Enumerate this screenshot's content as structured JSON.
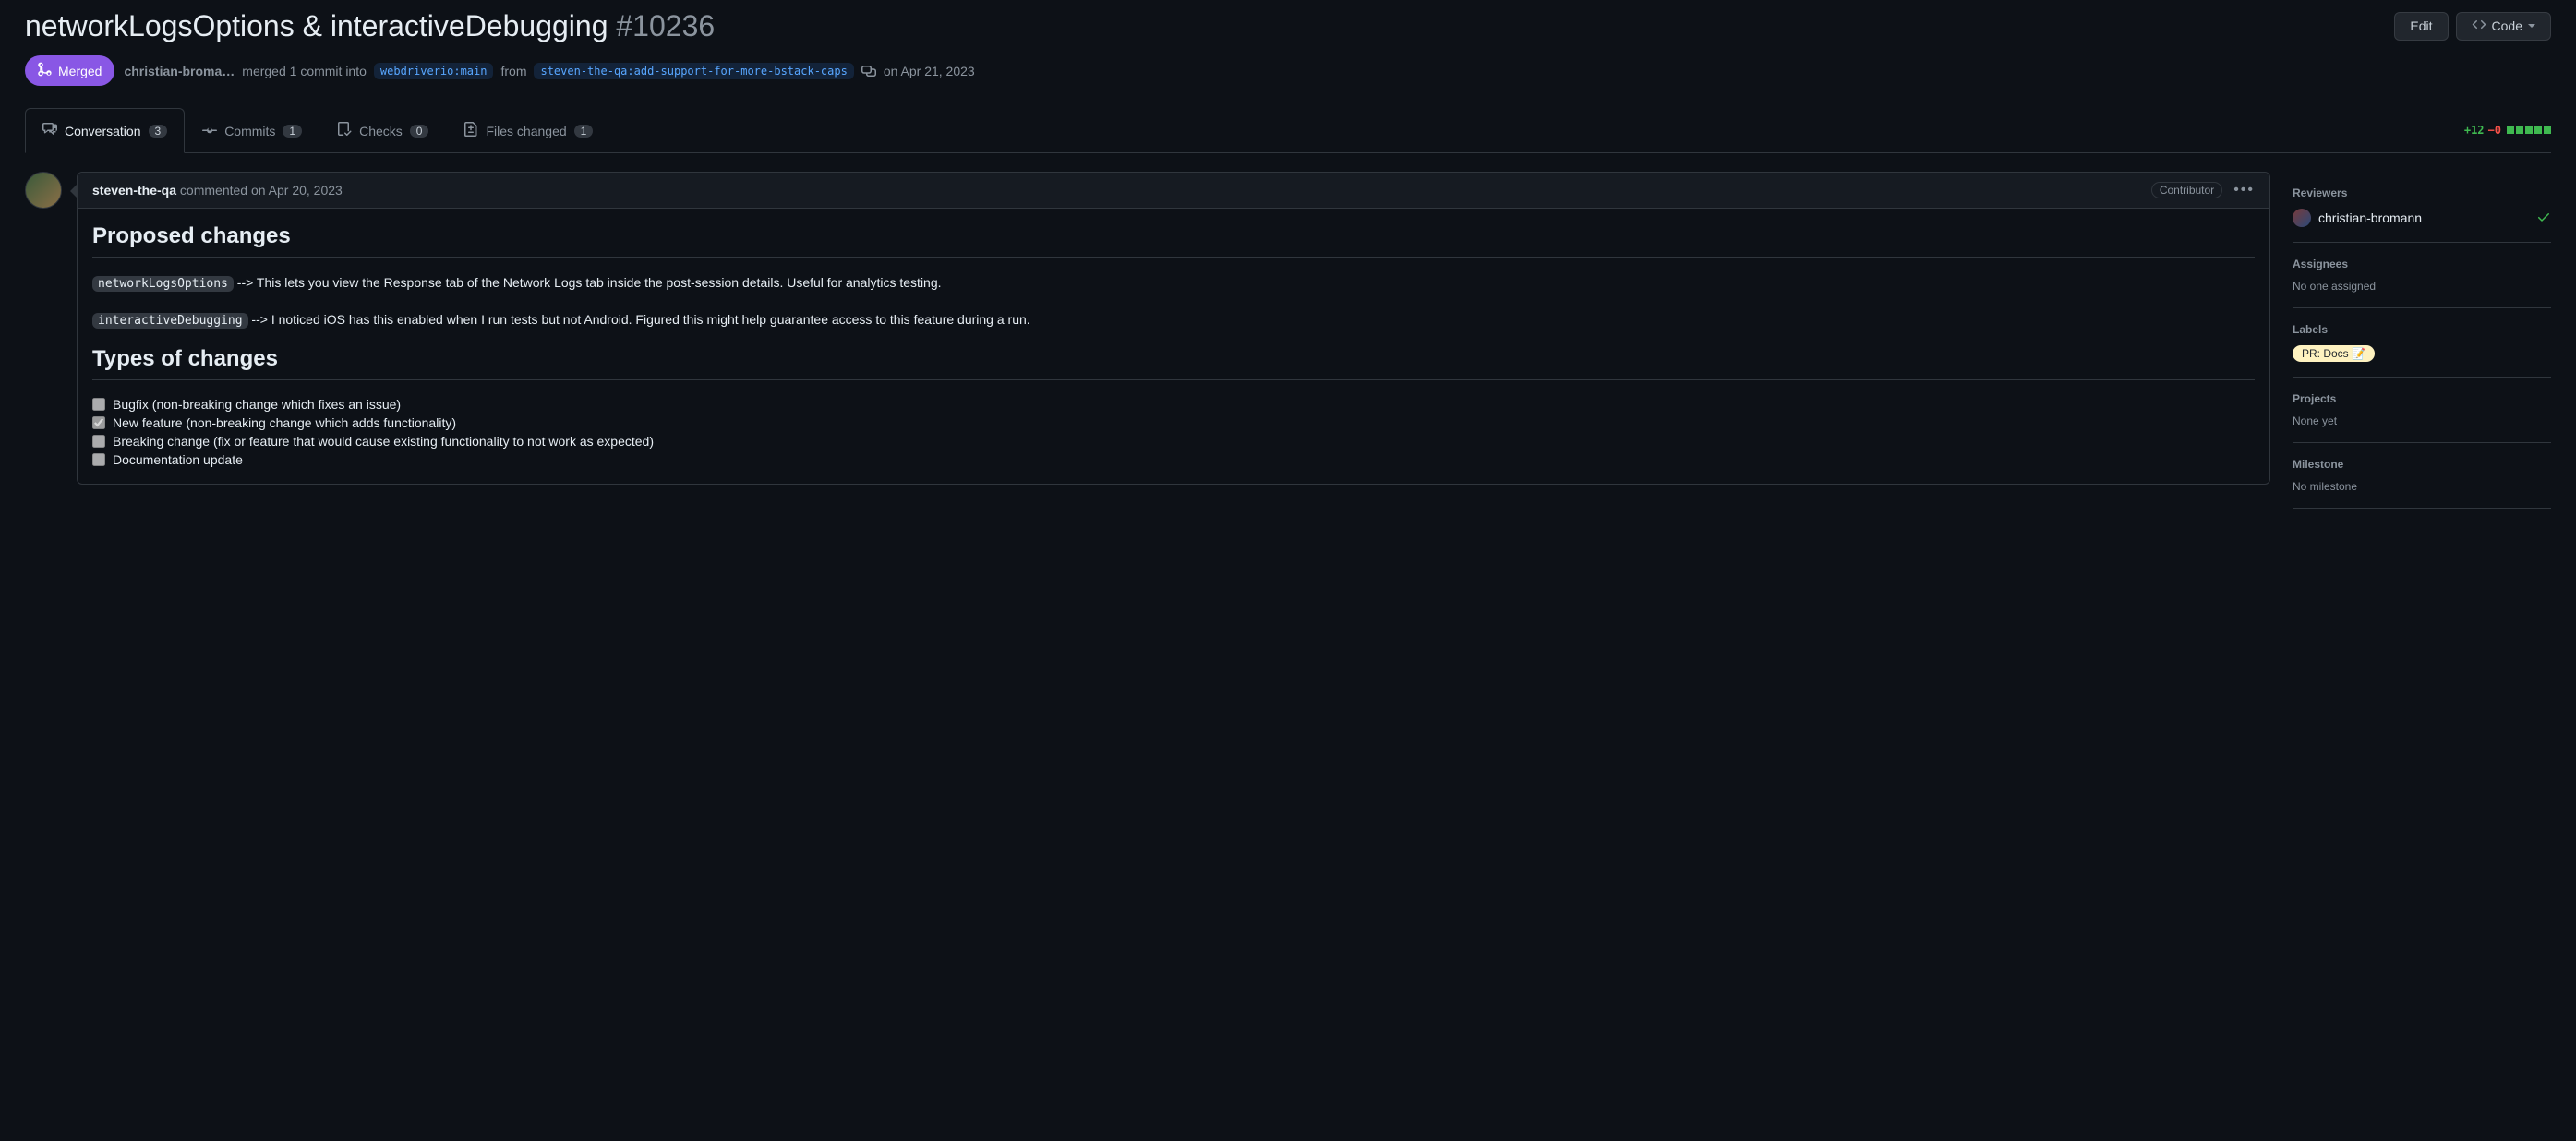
{
  "header": {
    "title": "networkLogsOptions & interactiveDebugging",
    "number": "#10236",
    "edit_label": "Edit",
    "code_label": "Code"
  },
  "meta": {
    "state": "Merged",
    "author": "christian-broma…",
    "merge_text_1": "merged 1 commit into",
    "base_branch": "webdriverio:main",
    "from_text": "from",
    "head_branch": "steven-the-qa:add-support-for-more-bstack-caps",
    "merge_date": "on Apr 21, 2023"
  },
  "tabs": {
    "conversation": {
      "label": "Conversation",
      "count": "3"
    },
    "commits": {
      "label": "Commits",
      "count": "1"
    },
    "checks": {
      "label": "Checks",
      "count": "0"
    },
    "files": {
      "label": "Files changed",
      "count": "1"
    }
  },
  "diffstat": {
    "additions": "+12",
    "deletions": "−0"
  },
  "comment": {
    "author": "steven-the-qa",
    "commented_text": "commented",
    "date": "on Apr 20, 2023",
    "badge": "Contributor",
    "h2_1": "Proposed changes",
    "code_1": "networkLogsOptions",
    "p1": " --> This lets you view the Response tab of the Network Logs tab inside the post-session details. Useful for analytics testing.",
    "code_2": "interactiveDebugging",
    "p2": " --> I noticed iOS has this enabled when I run tests but not Android. Figured this might help guarantee access to this feature during a run.",
    "h2_2": "Types of changes",
    "tasks": {
      "bugfix": "Bugfix (non-breaking change which fixes an issue)",
      "feature": "New feature (non-breaking change which adds functionality)",
      "breaking": "Breaking change (fix or feature that would cause existing functionality to not work as expected)",
      "docs": "Documentation update"
    }
  },
  "sidebar": {
    "reviewers": {
      "heading": "Reviewers",
      "name": "christian-bromann"
    },
    "assignees": {
      "heading": "Assignees",
      "body": "No one assigned"
    },
    "labels": {
      "heading": "Labels",
      "pill": "PR: Docs 📝"
    },
    "projects": {
      "heading": "Projects",
      "body": "None yet"
    },
    "milestone": {
      "heading": "Milestone",
      "body": "No milestone"
    }
  }
}
